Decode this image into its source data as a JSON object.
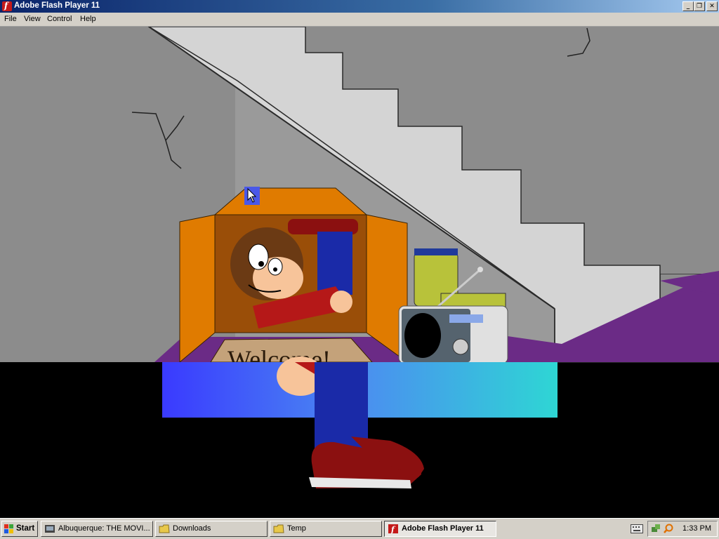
{
  "window": {
    "title": "Adobe Flash Player 11"
  },
  "menu": [
    "File",
    "View",
    "Control",
    "Help"
  ],
  "scene": {
    "sign_text": "Welcome!"
  },
  "taskbar": {
    "start_label": "Start",
    "tasks": [
      {
        "label": "Albuquerque: THE MOVI...",
        "icon": "browser-icon"
      },
      {
        "label": "Downloads",
        "icon": "folder-icon"
      },
      {
        "label": "Temp",
        "icon": "folder-icon"
      },
      {
        "label": "Adobe Flash Player 11",
        "icon": "flash-icon"
      }
    ],
    "clock": "1:33 PM"
  },
  "colors": {
    "title_gradient_start": "#0a246a",
    "wall": "#8c8c8c",
    "floor_rug": "#6b2b86",
    "box": "#e07b00",
    "gradient_bar_start": "#3a3aff",
    "gradient_bar_end": "#2ed6d4"
  }
}
